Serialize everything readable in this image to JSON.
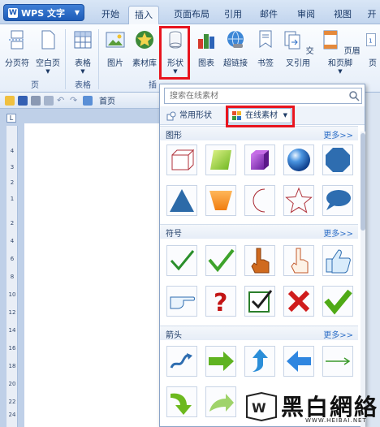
{
  "app": {
    "name": "WPS 文字",
    "logo": "W"
  },
  "tabs": [
    {
      "label": "开始"
    },
    {
      "label": "插入",
      "active": true
    },
    {
      "label": "页面布局"
    },
    {
      "label": "引用"
    },
    {
      "label": "邮件"
    },
    {
      "label": "审阅"
    },
    {
      "label": "视图"
    },
    {
      "label": "开"
    }
  ],
  "ribbon": {
    "buttons": [
      {
        "label": "分页符",
        "icon": "page-break-icon"
      },
      {
        "label": "空白页",
        "icon": "blank-page-icon"
      },
      {
        "label": "表格",
        "icon": "table-icon"
      },
      {
        "label": "图片",
        "icon": "picture-icon"
      },
      {
        "label": "素材库",
        "icon": "clip-library-icon"
      },
      {
        "label": "形状",
        "icon": "shapes-icon"
      },
      {
        "label": "图表",
        "icon": "chart-icon"
      },
      {
        "label": "超链接",
        "icon": "hyperlink-icon"
      },
      {
        "label": "书签",
        "icon": "bookmark-icon"
      },
      {
        "label": "交叉引用",
        "icon": "cross-reference-icon"
      },
      {
        "label": "页眉和页脚",
        "icon": "header-footer-icon"
      },
      {
        "label": "页",
        "icon": "page-number-icon"
      }
    ],
    "groups": [
      {
        "label": "页"
      },
      {
        "label": "表格"
      },
      {
        "label": "插"
      }
    ]
  },
  "quickbar": {
    "home_label": "首页"
  },
  "ruler": {
    "corner": "L",
    "numbers": [
      "4",
      "3",
      "2",
      "1",
      "2",
      "4",
      "6",
      "8",
      "10",
      "12",
      "14",
      "16",
      "18",
      "20",
      "22",
      "24",
      "26"
    ]
  },
  "shapes_panel": {
    "search_placeholder": "搜索在线素材",
    "tab_common": "常用形状",
    "tab_online": "在线素材",
    "sections": [
      {
        "title": "图形",
        "more": "更多>>"
      },
      {
        "title": "符号",
        "more": "更多>>"
      },
      {
        "title": "箭头",
        "more": "更多>>"
      }
    ]
  },
  "watermark": {
    "text": "黑白網絡",
    "url": "WWW.HEIBAI.NET"
  },
  "colors": {
    "highlight": "#e8141e",
    "accent": "#1e5cb8"
  }
}
